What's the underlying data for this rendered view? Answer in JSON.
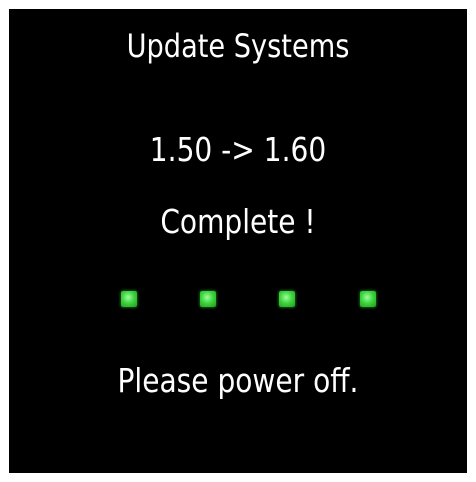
{
  "screen": {
    "title": "Update Systems",
    "version_change": "1.50 -> 1.60",
    "status": "Complete !",
    "progress": {
      "steps_completed": 4,
      "steps_total": 4,
      "indicator_color": "#33cc33"
    },
    "message": "Please power off."
  }
}
